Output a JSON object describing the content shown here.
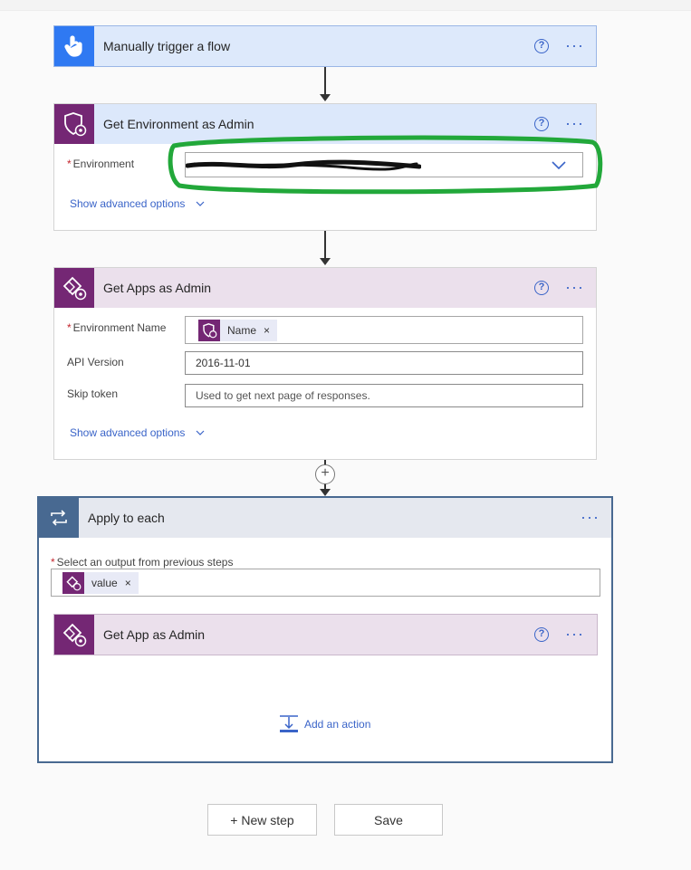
{
  "trigger": {
    "title": "Manually trigger a flow"
  },
  "get_environment": {
    "title": "Get Environment as Admin",
    "environment_label": "Environment",
    "environment_value": "",
    "advanced": "Show advanced options"
  },
  "get_apps": {
    "title": "Get Apps as Admin",
    "env_name_label": "Environment Name",
    "env_name_token": "Name",
    "api_version_label": "API Version",
    "api_version_value": "2016-11-01",
    "skip_token_label": "Skip token",
    "skip_token_placeholder": "Used to get next page of responses.",
    "advanced": "Show advanced options"
  },
  "apply_to_each": {
    "title": "Apply to each",
    "select_label": "Select an output from previous steps",
    "select_token": "value",
    "inner_action_title": "Get App as Admin",
    "add_action": "Add an action"
  },
  "footer": {
    "new_step": "+ New step",
    "save": "Save"
  },
  "colors": {
    "trigger_accent": "#2f79f2",
    "trigger_header": "#dde9fb",
    "admin_purple": "#742774",
    "env_header": "#dce8fb",
    "apps_header": "#ebe0ec",
    "loop_accent": "#486991",
    "loop_header": "#e5e8ef",
    "highlight_green": "#22a83a",
    "link_blue": "#3a64c8"
  },
  "icons": {
    "trigger": "touch-hand-icon",
    "environment": "shield-gear-icon",
    "apps": "powerapps-gear-icon",
    "loop": "loop-arrows-icon"
  }
}
